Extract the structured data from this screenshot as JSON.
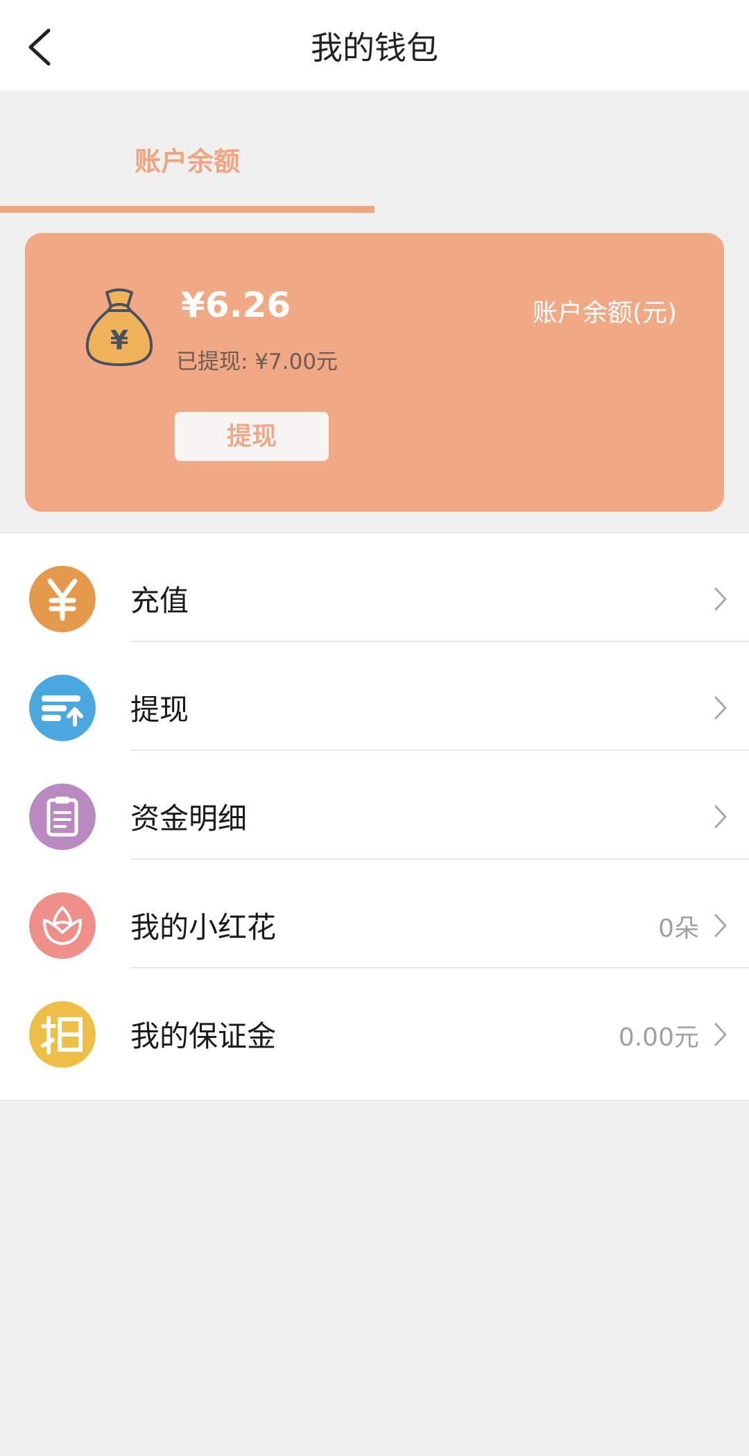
{
  "header": {
    "title": "我的钱包",
    "back_icon": "chevron-left-icon"
  },
  "tabs": [
    {
      "label": "账户余额",
      "active": true
    }
  ],
  "balance_card": {
    "amount": "¥6.26",
    "withdrawn": "已提现: ¥7.00元",
    "label": "账户余额(元)",
    "withdraw_button": "提现",
    "icon": "money-bag-icon",
    "color": "#f1a884"
  },
  "menu": [
    {
      "label": "充值",
      "value": "",
      "icon": "yen-icon",
      "color": "#e49a4a"
    },
    {
      "label": "提现",
      "value": "",
      "icon": "withdraw-icon",
      "color": "#4aa8de"
    },
    {
      "label": "资金明细",
      "value": "",
      "icon": "clipboard-icon",
      "color": "#b98ac0"
    },
    {
      "label": "我的小红花",
      "value": "0朵",
      "icon": "flower-icon",
      "color": "#ef8f8a"
    },
    {
      "label": "我的保证金",
      "value": "0.00元",
      "icon": "guarantee-icon",
      "color": "#efbe46"
    }
  ]
}
